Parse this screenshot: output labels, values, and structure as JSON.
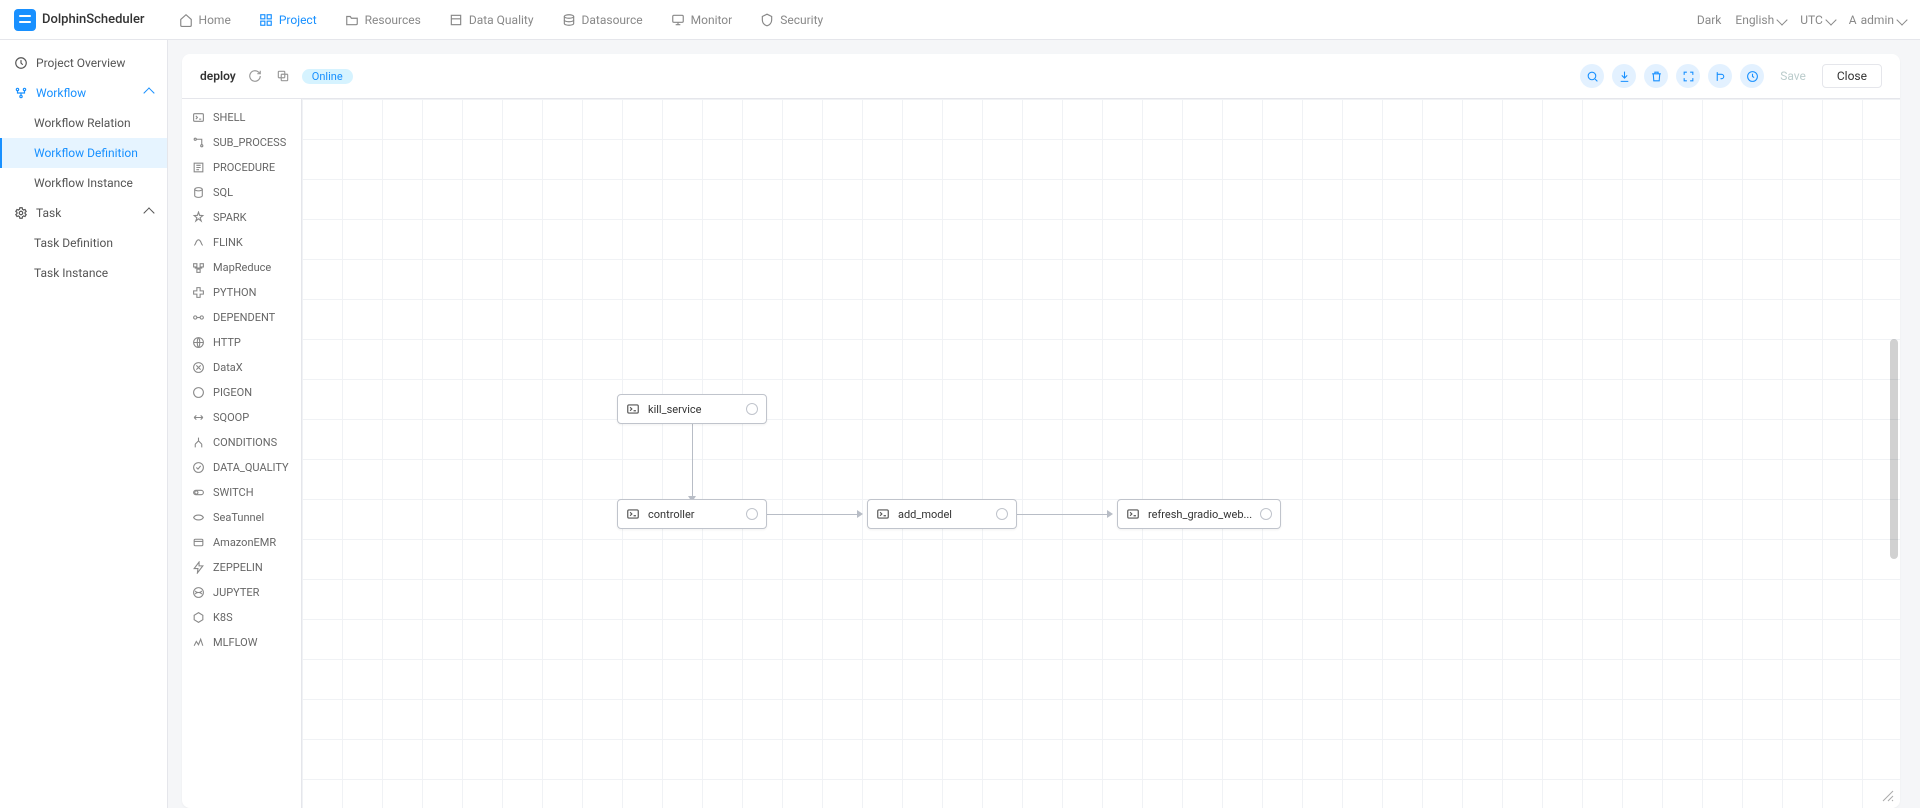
{
  "brand": "DolphinScheduler",
  "nav": {
    "home": "Home",
    "project": "Project",
    "resources": "Resources",
    "data_quality": "Data Quality",
    "datasource": "Datasource",
    "monitor": "Monitor",
    "security": "Security"
  },
  "topright": {
    "theme": "Dark",
    "lang": "English",
    "tz": "UTC",
    "user_prefix": "A",
    "user": "admin"
  },
  "sidebar": {
    "overview": "Project Overview",
    "workflow": "Workflow",
    "wf_relation": "Workflow Relation",
    "wf_definition": "Workflow Definition",
    "wf_instance": "Workflow Instance",
    "task": "Task",
    "task_definition": "Task Definition",
    "task_instance": "Task Instance"
  },
  "head": {
    "wf_name": "deploy",
    "status": "Online",
    "save": "Save",
    "close": "Close"
  },
  "palette": [
    "SHELL",
    "SUB_PROCESS",
    "PROCEDURE",
    "SQL",
    "SPARK",
    "FLINK",
    "MapReduce",
    "PYTHON",
    "DEPENDENT",
    "HTTP",
    "DataX",
    "PIGEON",
    "SQOOP",
    "CONDITIONS",
    "DATA_QUALITY",
    "SWITCH",
    "SeaTunnel",
    "AmazonEMR",
    "ZEPPELIN",
    "JUPYTER",
    "K8S",
    "MLFLOW"
  ],
  "nodes": {
    "kill_service": "kill_service",
    "controller": "controller",
    "add_model": "add_model",
    "refresh": "refresh_gradio_web..."
  }
}
